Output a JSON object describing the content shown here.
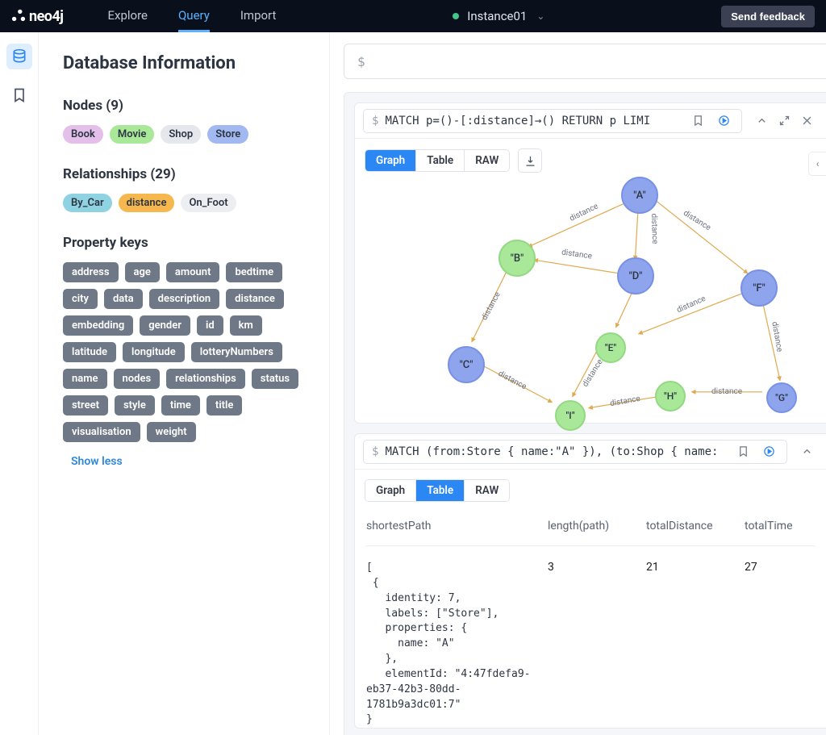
{
  "topbar": {
    "logo": "neo4j",
    "nav": [
      {
        "label": "Explore",
        "active": false
      },
      {
        "label": "Query",
        "active": true
      },
      {
        "label": "Import",
        "active": false
      }
    ],
    "instance": "Instance01",
    "feedback": "Send feedback"
  },
  "sidebar": {
    "title": "Database Information",
    "nodes_header": "Nodes (9)",
    "node_labels": [
      {
        "label": "Book",
        "color": "purple"
      },
      {
        "label": "Movie",
        "color": "green"
      },
      {
        "label": "Shop",
        "color": "grey"
      },
      {
        "label": "Store",
        "color": "blue"
      }
    ],
    "rels_header": "Relationships (29)",
    "rel_types": [
      {
        "label": "By_Car",
        "color": "teal"
      },
      {
        "label": "distance",
        "color": "orange"
      },
      {
        "label": "On_Foot",
        "color": "lgrey"
      }
    ],
    "keys_header": "Property keys",
    "keys": [
      "address",
      "age",
      "amount",
      "bedtime",
      "city",
      "data",
      "description",
      "distance",
      "embedding",
      "gender",
      "id",
      "km",
      "latitude",
      "longitude",
      "lotteryNumbers",
      "name",
      "nodes",
      "relationships",
      "status",
      "street",
      "style",
      "time",
      "title",
      "visualisation",
      "weight"
    ],
    "show_less": "Show less"
  },
  "prompt": {
    "dollar": "$"
  },
  "card1": {
    "query": "MATCH p=()-[:distance]→() RETURN p LIMI",
    "tabs": [
      "Graph",
      "Table",
      "RAW"
    ],
    "active_tab": "Graph",
    "edge_label": "distance",
    "nodes": {
      "A": "\"A\"",
      "B": "\"B\"",
      "C": "\"C\"",
      "D": "\"D\"",
      "E": "\"E\"",
      "F": "\"F\"",
      "G": "\"G\"",
      "H": "\"H\"",
      "I": "\"I\""
    }
  },
  "card2": {
    "query": "MATCH (from:Store { name:\"A\" }), (to:Shop { name: \"I\"}",
    "tabs": [
      "Graph",
      "Table",
      "RAW"
    ],
    "active_tab": "Table",
    "columns": [
      "shortestPath",
      "length(path)",
      "totalDistance",
      "totalTime"
    ],
    "row": {
      "length": "3",
      "totalDistance": "21",
      "totalTime": "27",
      "json": "[\n {\n   identity: 7,\n   labels: [\"Store\"],\n   properties: {\n     name: \"A\"\n   },\n   elementId: \"4:47fdefa9-\neb37-42b3-80dd-\n1781b9a3dc01:7\"\n}"
    }
  },
  "icons": {
    "database": "database-icon",
    "bookmark": "bookmark-icon"
  }
}
